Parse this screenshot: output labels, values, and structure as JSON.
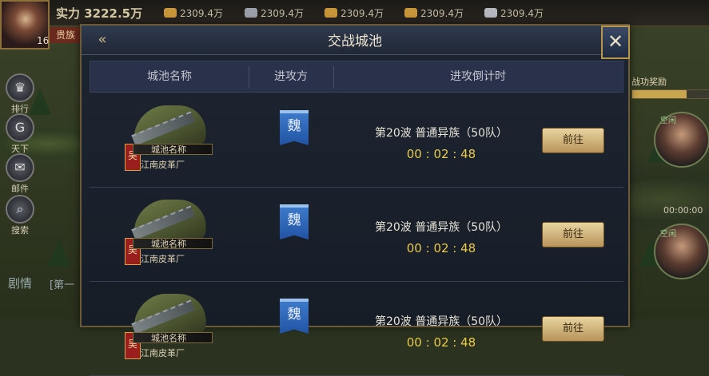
{
  "player": {
    "level": "16",
    "power": "实力 3222.5万",
    "nobility": "贵族",
    "resources": [
      "2309.4万",
      "2309.4万",
      "2309.4万",
      "2309.4万",
      "2309.4万"
    ],
    "resource_colors": [
      "#c9953a",
      "#9aa0a7",
      "#c9953a",
      "#c9953a",
      "#b5b8bf"
    ]
  },
  "left_menu": [
    "排行",
    "天下",
    "邮件",
    "搜索"
  ],
  "story": {
    "label": "剧情",
    "chapter": "[第一"
  },
  "right_panel": {
    "reward_title": "战功奖励",
    "tags": [
      "空闲",
      "空闲"
    ],
    "timer": "00:00:00"
  },
  "dialog": {
    "title": "交战城池",
    "columns": [
      "城池名称",
      "进攻方",
      "进攻倒计时"
    ],
    "rows": [
      {
        "city_name": "城池名称",
        "city_sub": "江南皮革厂",
        "rank": "吴",
        "attacker": "魏",
        "wave": "第20波 普通异族（50队）",
        "countdown": "00 : 02 : 48",
        "go": "前往"
      },
      {
        "city_name": "城池名称",
        "city_sub": "江南皮革厂",
        "rank": "吴",
        "attacker": "魏",
        "wave": "第20波 普通异族（50队）",
        "countdown": "00 : 02 : 48",
        "go": "前往"
      },
      {
        "city_name": "城池名称",
        "city_sub": "江南皮革厂",
        "rank": "吴",
        "attacker": "魏",
        "wave": "第20波 普通异族（50队）",
        "countdown": "00 : 02 : 48",
        "go": "前往"
      }
    ]
  }
}
